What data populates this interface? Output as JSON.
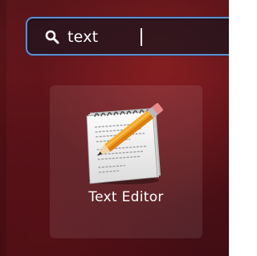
{
  "search": {
    "query": "text",
    "icon": "search-icon"
  },
  "results": [
    {
      "label": "Text Editor",
      "icon": "text-editor-icon"
    }
  ],
  "colors": {
    "accent": "#5f8fd0",
    "background": "#5a1219",
    "text": "#ffffff"
  }
}
